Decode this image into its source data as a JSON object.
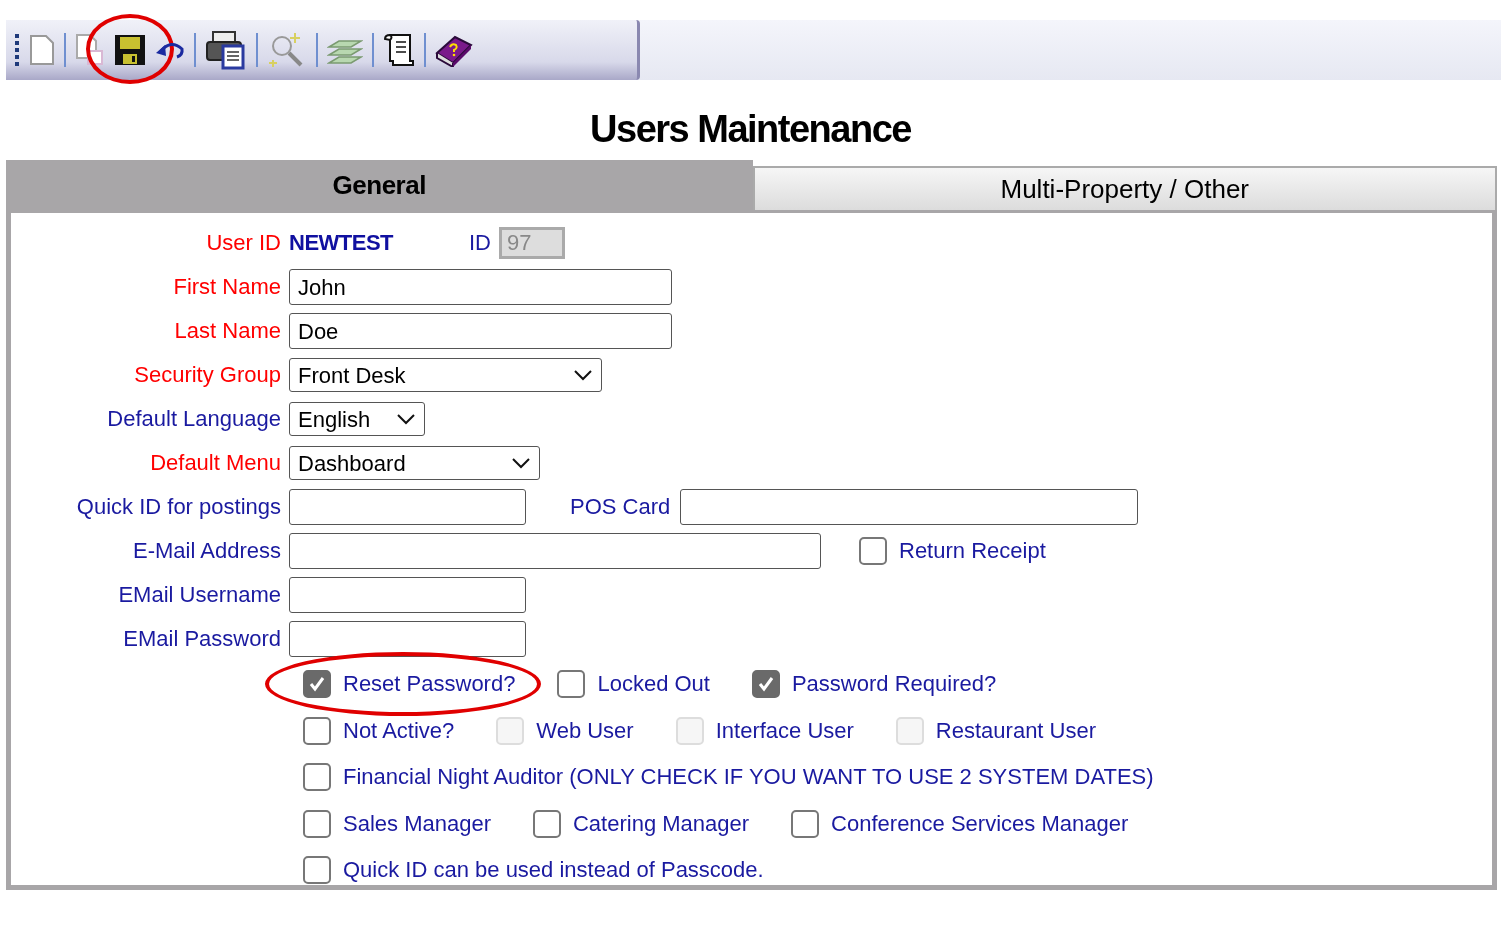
{
  "toolbar": [
    {
      "kind": "grip"
    },
    {
      "kind": "new-page",
      "disabled": false
    },
    {
      "kind": "copy-page",
      "disabled": true
    },
    {
      "kind": "save",
      "circled": true
    },
    {
      "kind": "undo"
    },
    {
      "kind": "print"
    },
    {
      "kind": "zoom"
    },
    {
      "kind": "money"
    },
    {
      "kind": "scroll"
    },
    {
      "kind": "help"
    }
  ],
  "title": "Users Maintenance",
  "tabs": [
    {
      "label": "General",
      "selected": true
    },
    {
      "label": "Multi-Property / Other",
      "selected": false
    }
  ],
  "user_id": {
    "label": "User ID",
    "required": true,
    "value": "NEWTEST",
    "id_label": "ID",
    "id_value": "97"
  },
  "fields": [
    {
      "label": "First Name",
      "required": true,
      "kind": "text",
      "value": "John"
    },
    {
      "label": "Last Name",
      "required": true,
      "kind": "text",
      "value": "Doe"
    },
    {
      "label": "Security Group",
      "required": true,
      "kind": "select",
      "value": "Front Desk"
    },
    {
      "label": "Default Language",
      "required": false,
      "kind": "select",
      "value": "English"
    },
    {
      "label": "Default Menu",
      "required": true,
      "kind": "select",
      "value": "Dashboard"
    },
    {
      "label": "Quick ID for postings",
      "required": false,
      "kind": "text",
      "side": {
        "kind": "field",
        "label": "POS Card"
      }
    },
    {
      "label": "E-Mail Address",
      "required": false,
      "kind": "text",
      "side": {
        "kind": "checkbox",
        "label": "Return Receipt",
        "checked": false
      }
    },
    {
      "label": "EMail Username",
      "required": false,
      "kind": "text"
    },
    {
      "label": "EMail Password",
      "required": false,
      "kind": "text"
    }
  ],
  "checkbox_rows": [
    [
      {
        "label": "Reset Password?",
        "checked": true,
        "disabled": false,
        "circled": true
      },
      {
        "label": "Locked Out",
        "checked": false,
        "disabled": false,
        "circled": false
      },
      {
        "label": "Password Required?",
        "checked": true,
        "disabled": false,
        "circled": false
      }
    ],
    [
      {
        "label": "Not Active?",
        "checked": false,
        "disabled": false,
        "circled": false
      },
      {
        "label": "Web User",
        "checked": false,
        "disabled": true,
        "circled": false
      },
      {
        "label": "Interface User",
        "checked": false,
        "disabled": true,
        "circled": false
      },
      {
        "label": "Restaurant User",
        "checked": false,
        "disabled": true,
        "circled": false
      }
    ],
    [
      {
        "label": "Financial Night Auditor (ONLY CHECK IF YOU WANT TO USE 2 SYSTEM DATES)",
        "checked": false,
        "disabled": false,
        "circled": false
      }
    ],
    [
      {
        "label": "Sales Manager",
        "checked": false,
        "disabled": false,
        "circled": false
      },
      {
        "label": "Catering Manager",
        "checked": false,
        "disabled": false,
        "circled": false
      },
      {
        "label": "Conference Services Manager",
        "checked": false,
        "disabled": false,
        "circled": false
      }
    ],
    [
      {
        "label": "Quick ID can be used instead of Passcode.",
        "checked": false,
        "disabled": false,
        "circled": false
      }
    ]
  ]
}
